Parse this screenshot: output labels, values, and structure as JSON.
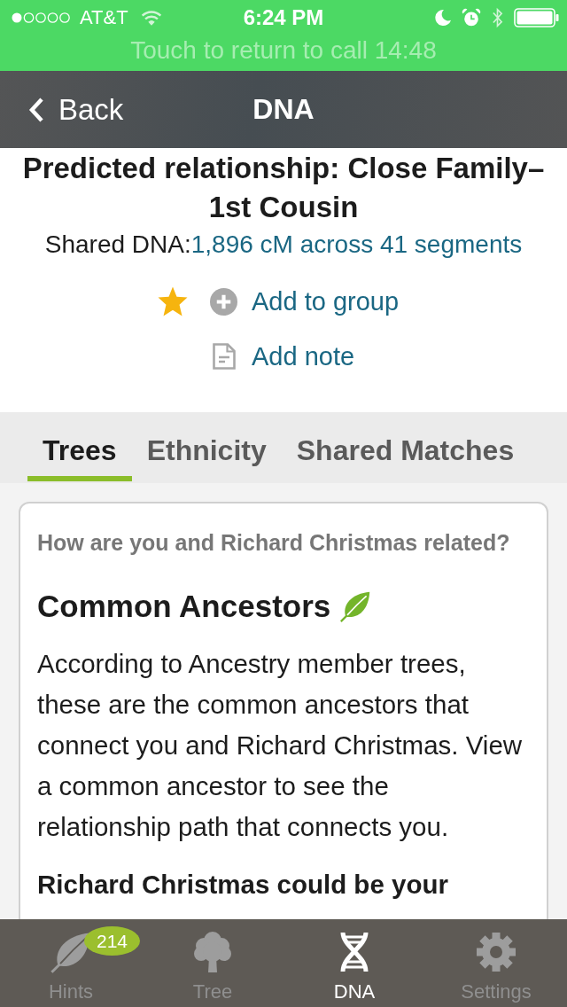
{
  "status_bar": {
    "carrier": "AT&T",
    "time": "6:24 PM"
  },
  "call_banner": {
    "text": "Touch to return to call 14:48"
  },
  "nav_bar": {
    "back": "Back",
    "title": "DNA"
  },
  "match": {
    "relationship": "Predicted relationship: Close Family–1st Cousin",
    "shared_dna_label": "Shared DNA:",
    "shared_dna_value": "1,896 cM across 41 segments",
    "starred": true,
    "actions": [
      {
        "label": "Add to group"
      },
      {
        "label": "Add note"
      }
    ]
  },
  "tabs": [
    {
      "label": "Trees",
      "selected": true
    },
    {
      "label": "Ethnicity",
      "selected": false
    },
    {
      "label": "Shared Matches",
      "selected": false
    }
  ],
  "card": {
    "question": "How are you and Richard Christmas related?",
    "heading": "Common Ancestors",
    "body": "According to Ancestry member trees, these are the common ancestors that connect you and Richard Christmas. View a common ancestor to see the relationship path that connects you.",
    "bold_line": "Richard Christmas could be your"
  },
  "tab_bar": [
    {
      "label": "Hints",
      "selected": false,
      "badge": "214"
    },
    {
      "label": "Tree",
      "selected": false
    },
    {
      "label": "DNA",
      "selected": true
    },
    {
      "label": "Settings",
      "selected": false
    }
  ]
}
